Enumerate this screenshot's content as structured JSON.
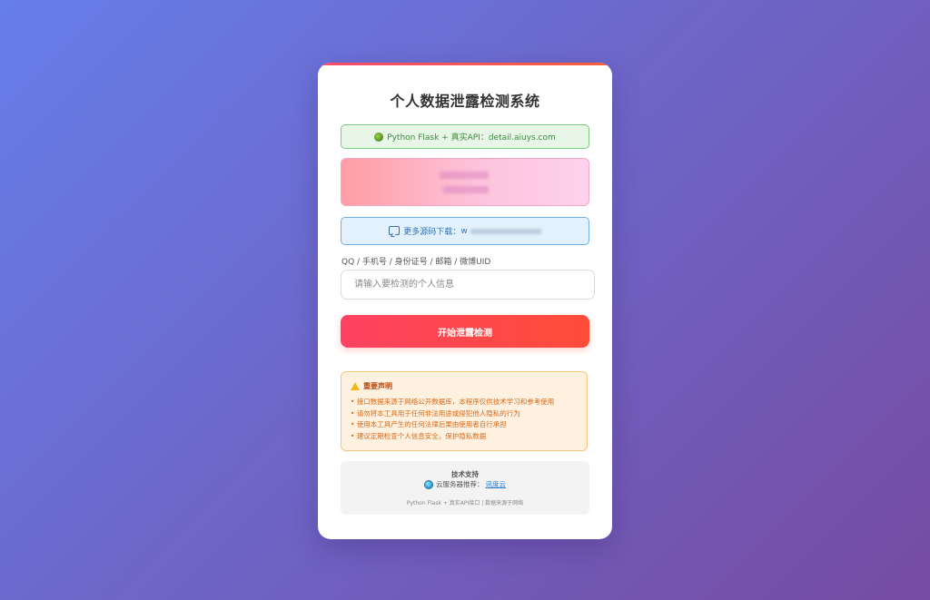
{
  "app": {
    "title": "个人数据泄露检测系统"
  },
  "api_notice": {
    "text": "Python Flask + 真实API：detail.aiuys.com",
    "icon": "snake-icon"
  },
  "source_notice": {
    "label": "更多源码下载：",
    "prefix": "w",
    "icon": "chat-icon"
  },
  "form": {
    "label": "QQ / 手机号 / 身份证号 / 邮箱 / 微博UID",
    "placeholder": "请输入要检测的个人信息",
    "value": "",
    "submit_label": "开始泄露检测"
  },
  "disclaimer": {
    "title": "重要声明",
    "items": [
      "接口数据来源于网络公开数据库，本程序仅供技术学习和参考使用",
      "请勿将本工具用于任何非法用途或侵犯他人隐私的行为",
      "使用本工具产生的任何法律后果由使用者自行承担",
      "建议定期检查个人信息安全，保护隐私数据"
    ]
  },
  "footer": {
    "title": "技术支持",
    "server_label": "云服务器推荐：",
    "server_link": "讯度云",
    "note": "Python Flask + 真实API接口 | 数据来源于网络"
  },
  "colors": {
    "background_start": "#667eea",
    "background_end": "#764ba2",
    "accent": "#ff4262",
    "api_green": "#3c8a3e",
    "source_blue": "#2f74b4",
    "warning_orange": "#d66a1a"
  }
}
